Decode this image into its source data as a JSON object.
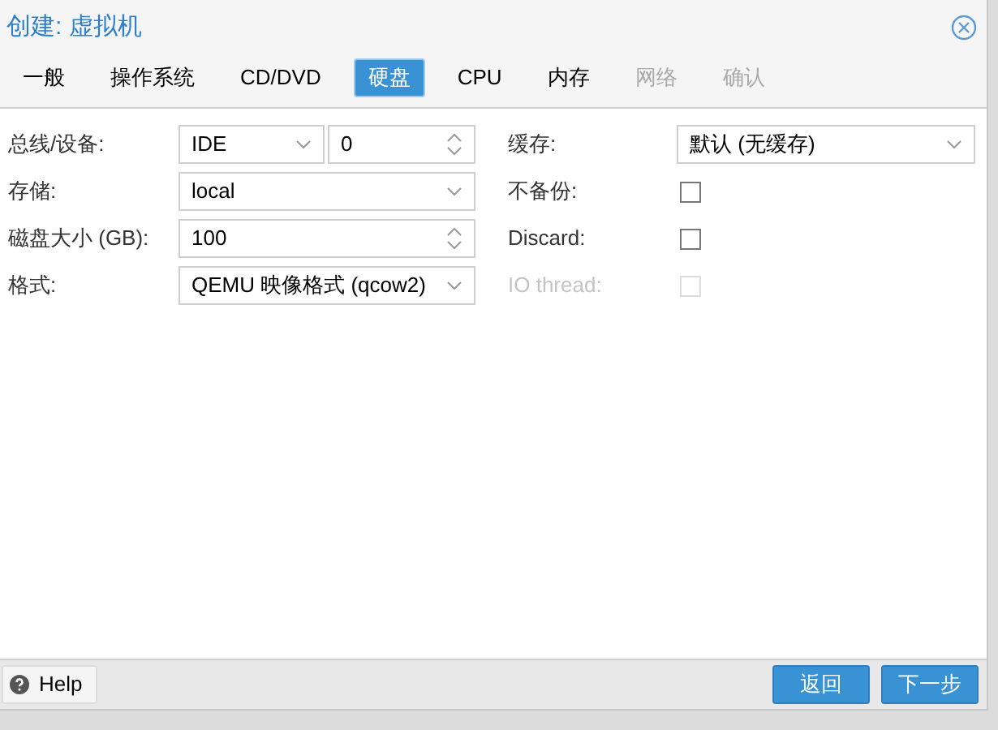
{
  "window": {
    "title": "创建: 虚拟机"
  },
  "tabs": [
    {
      "label": "一般",
      "selected": false,
      "disabled": false
    },
    {
      "label": "操作系统",
      "selected": false,
      "disabled": false
    },
    {
      "label": "CD/DVD",
      "selected": false,
      "disabled": false
    },
    {
      "label": "硬盘",
      "selected": true,
      "disabled": false
    },
    {
      "label": "CPU",
      "selected": false,
      "disabled": false
    },
    {
      "label": "内存",
      "selected": false,
      "disabled": false
    },
    {
      "label": "网络",
      "selected": false,
      "disabled": true
    },
    {
      "label": "确认",
      "selected": false,
      "disabled": true
    }
  ],
  "left_fields": [
    {
      "label": "总线/设备:",
      "kind": "pair",
      "value": "IDE",
      "value_2": "0"
    },
    {
      "label": "存储:",
      "kind": "select",
      "value": "local"
    },
    {
      "label": "磁盘大小 (GB):",
      "kind": "spinner",
      "value": "100"
    },
    {
      "label": "格式:",
      "kind": "select",
      "value": "QEMU 映像格式 (qcow2)"
    }
  ],
  "right_fields": [
    {
      "label": "缓存:",
      "kind": "select",
      "value": "默认 (无缓存)",
      "disabled": false
    },
    {
      "label": "不备份:",
      "kind": "checkbox",
      "checked": false,
      "disabled": false
    },
    {
      "label": "Discard:",
      "kind": "checkbox",
      "checked": false,
      "disabled": false
    },
    {
      "label": "IO thread:",
      "kind": "checkbox",
      "checked": false,
      "disabled": true
    }
  ],
  "footer": {
    "help": "Help",
    "buttons": [
      "返回",
      "下一步"
    ]
  }
}
